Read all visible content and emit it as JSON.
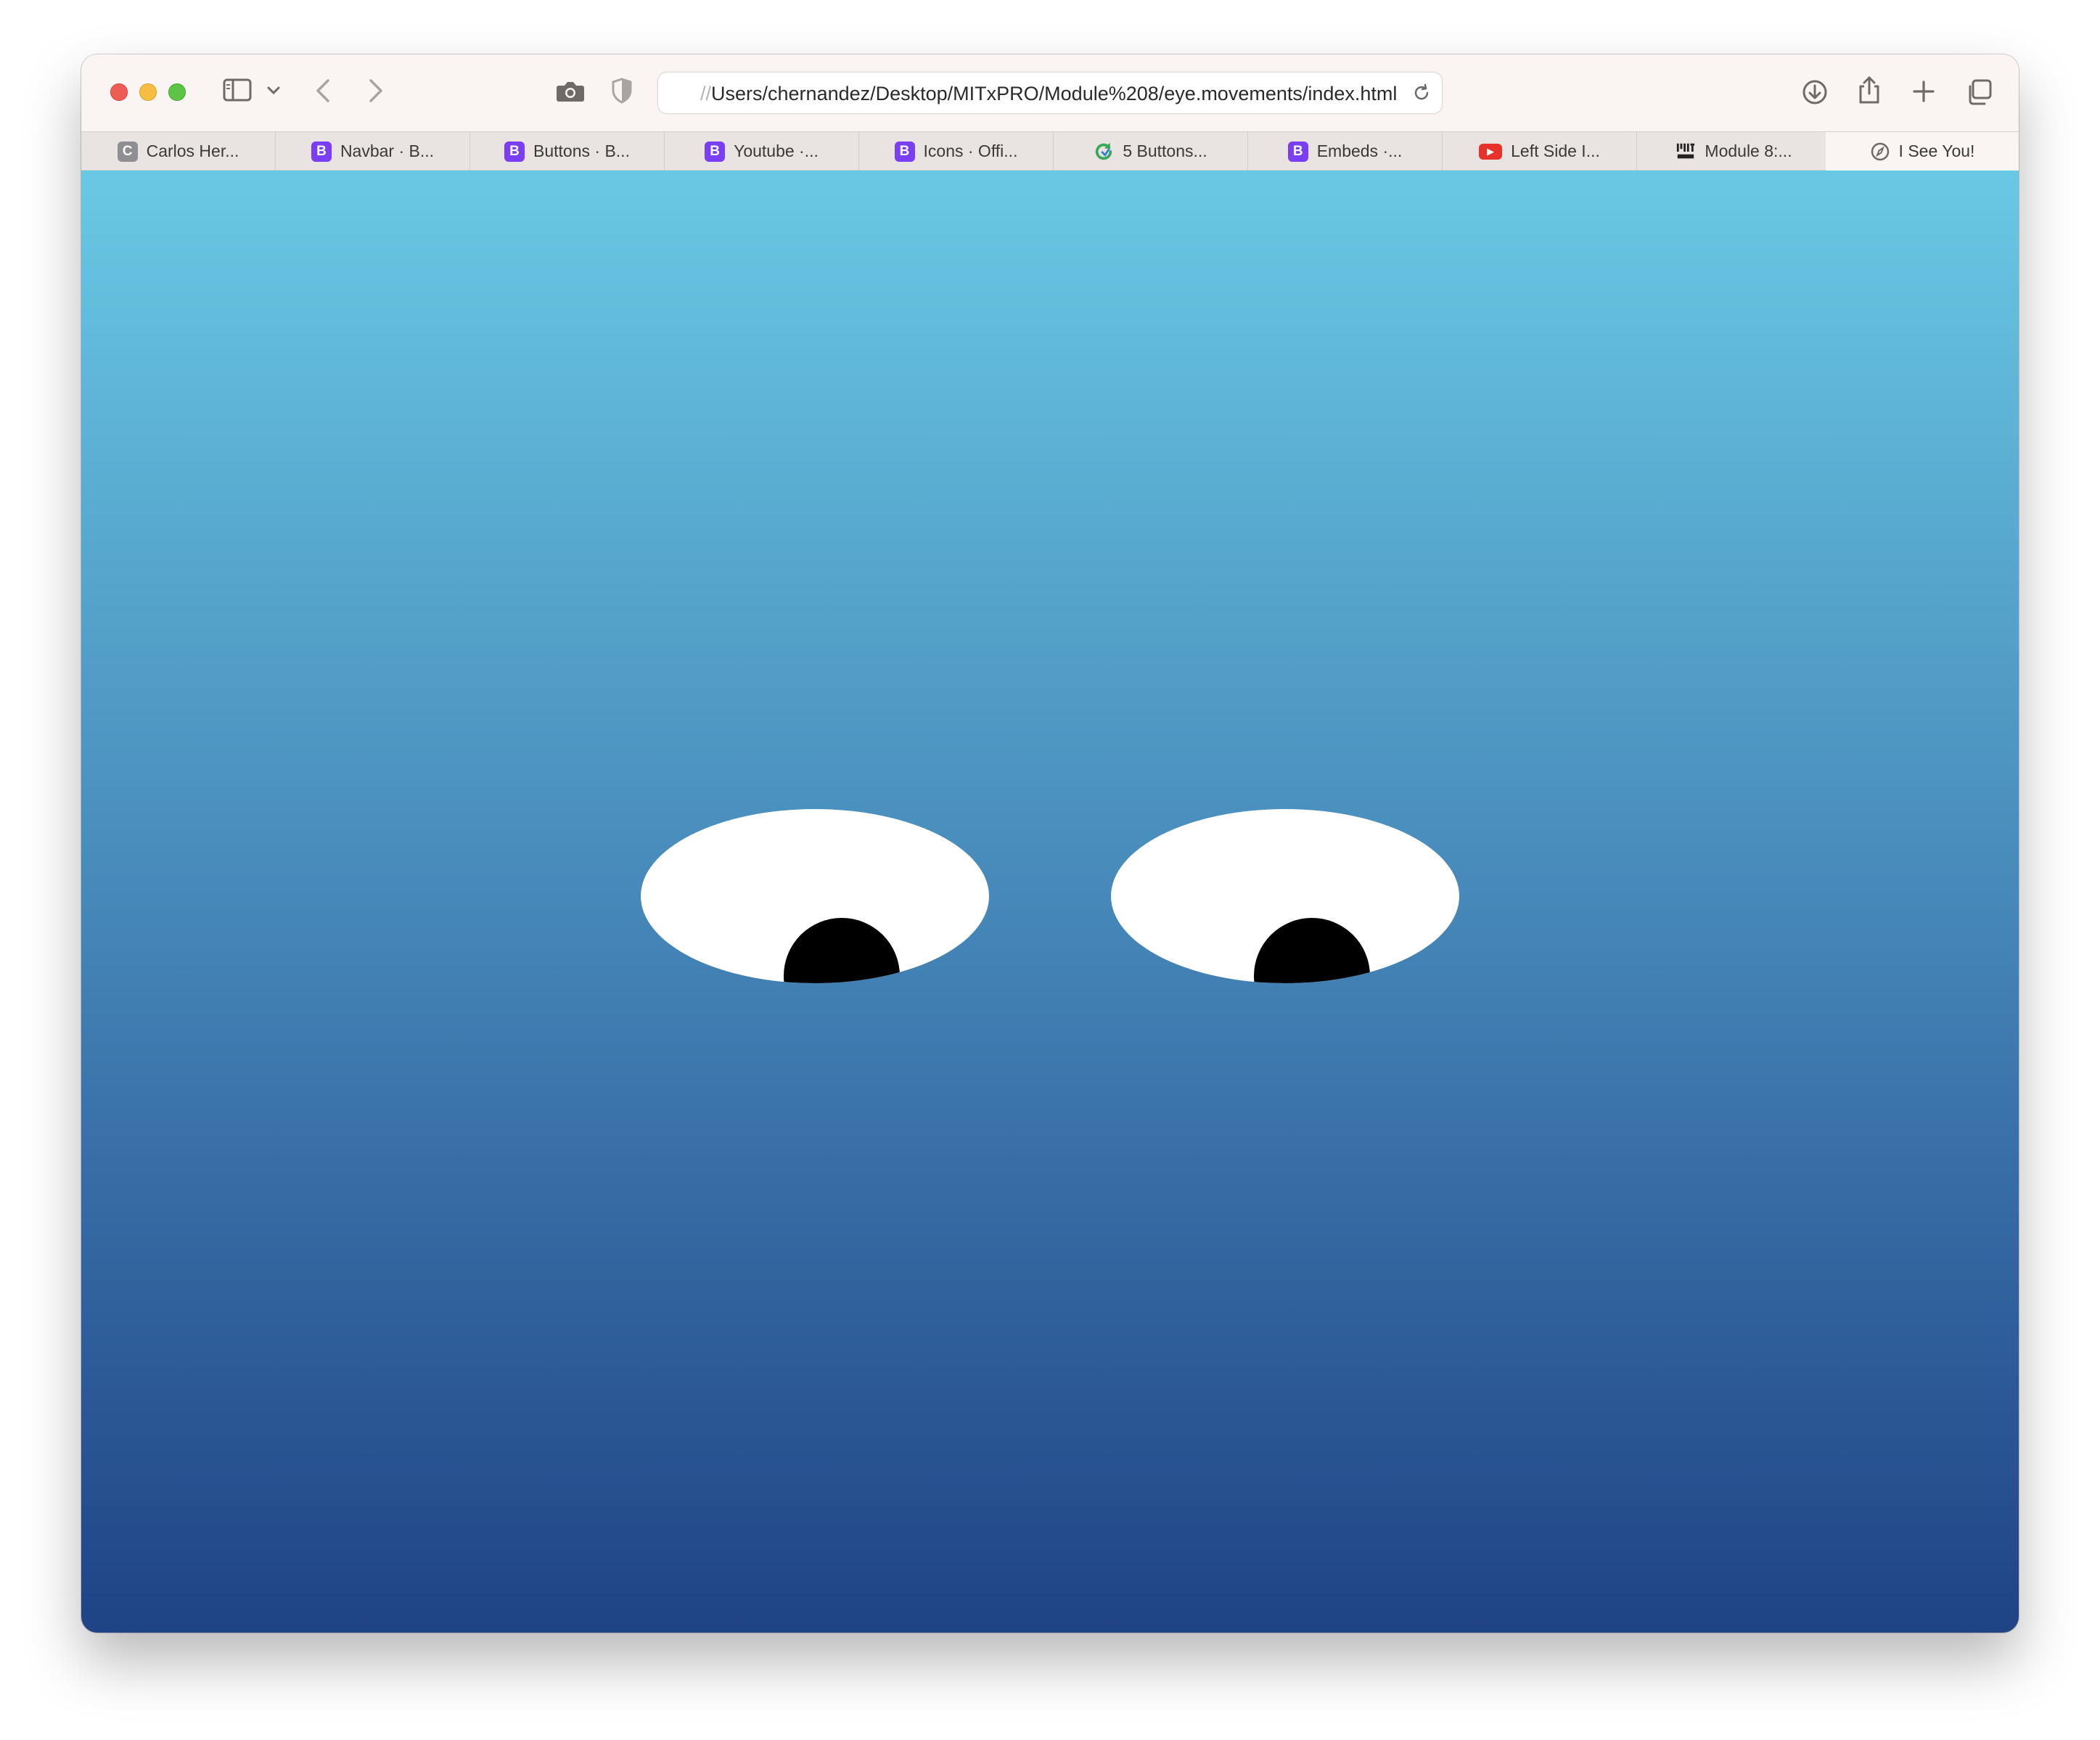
{
  "browser": {
    "address": {
      "prefix": "//",
      "path": "Users/chernandez/Desktop/MITxPRO/Module%208/eye.movements/index.html"
    },
    "tabs": [
      {
        "label": "Carlos Her...",
        "favicon": "letter-c-icon",
        "favicon_text": "C",
        "favicon_color": "#8e8e93"
      },
      {
        "label": "Navbar · B...",
        "favicon": "bootstrap-icon",
        "favicon_text": "B",
        "favicon_color": "#7a3ef4"
      },
      {
        "label": "Buttons · B...",
        "favicon": "bootstrap-icon",
        "favicon_text": "B",
        "favicon_color": "#7a3ef4"
      },
      {
        "label": "Youtube ·...",
        "favicon": "bootstrap-icon",
        "favicon_text": "B",
        "favicon_color": "#7a3ef4"
      },
      {
        "label": "Icons · Offi...",
        "favicon": "bootstrap-icon",
        "favicon_text": "B",
        "favicon_color": "#7a3ef4"
      },
      {
        "label": "5 Buttons...",
        "favicon": "refresh-arrow-icon",
        "favicon_text": "",
        "favicon_color": "#3aa85a"
      },
      {
        "label": "Embeds ·...",
        "favicon": "bootstrap-icon",
        "favicon_text": "B",
        "favicon_color": "#7a3ef4"
      },
      {
        "label": "Left Side I...",
        "favicon": "youtube-icon",
        "favicon_text": "▶",
        "favicon_color": "#e8312a"
      },
      {
        "label": "Module 8:...",
        "favicon": "mitxpro-logo-icon",
        "favicon_text": "",
        "favicon_color": "#222222"
      },
      {
        "label": "I See You!",
        "favicon": "compass-icon",
        "favicon_text": "",
        "favicon_color": "#6f6a67",
        "active": true
      }
    ]
  },
  "page": {
    "background_top": "#69c9e4",
    "background_bottom": "#1f4385",
    "eye_color": "#ffffff",
    "pupil_color": "#000000"
  }
}
